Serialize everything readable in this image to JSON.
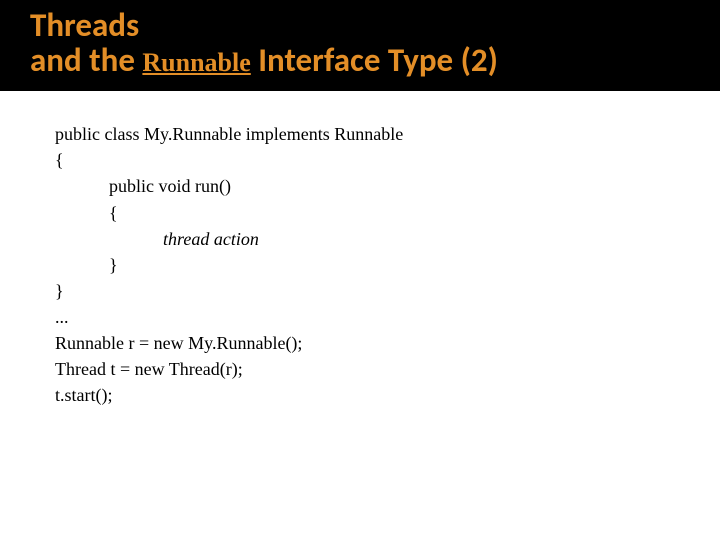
{
  "header": {
    "line1": "Threads",
    "line2_a": "and the ",
    "line2_runnable": "Runnable",
    "line2_b": " Interface Type (2)"
  },
  "code": {
    "l1": "public class My.Runnable implements Runnable",
    "l2": "{",
    "l3": "            public void run()",
    "l4": "            {",
    "l5a": "                        ",
    "l5b": "thread action",
    "l6": "            }",
    "l7": "}",
    "l8": "...",
    "l9": "Runnable r = new My.Runnable();",
    "l10": "Thread t = new Thread(r);",
    "l11": "t.start();"
  }
}
